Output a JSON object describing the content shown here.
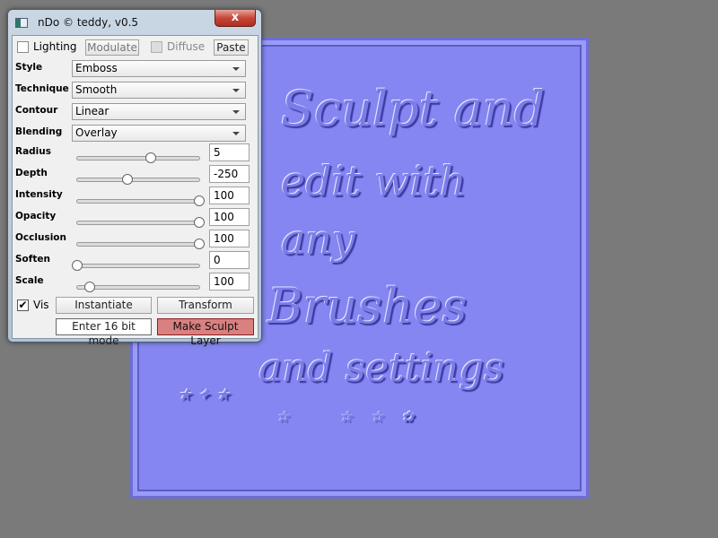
{
  "window": {
    "title": "nDo © teddy, v0.5",
    "close_label": "x"
  },
  "top_row": {
    "lighting_label": "Lighting",
    "lighting_checked": false,
    "modulate_label": "Modulate",
    "diffuse_label": "Diffuse",
    "diffuse_checked": false,
    "paste_label": "Paste"
  },
  "combos": [
    {
      "label": "Style",
      "value": "Emboss"
    },
    {
      "label": "Technique",
      "value": "Smooth"
    },
    {
      "label": "Contour",
      "value": "Linear"
    },
    {
      "label": "Blending",
      "value": "Overlay"
    }
  ],
  "sliders": [
    {
      "label": "Radius",
      "value": "5",
      "level": 0.6
    },
    {
      "label": "Depth",
      "value": "-250",
      "level": 0.41
    },
    {
      "label": "Intensity",
      "value": "100",
      "level": 1
    },
    {
      "label": "Opacity",
      "value": "100",
      "level": 1
    },
    {
      "label": "Occlusion",
      "value": "100",
      "level": 1
    },
    {
      "label": "Soften",
      "value": "0",
      "level": 0
    },
    {
      "label": "Scale",
      "value": "100",
      "level": 0.1
    }
  ],
  "bottom": {
    "vis_label": "Vis",
    "vis_checked": true,
    "instantiate_label": "Instantiate",
    "transform_label": "Transform",
    "enter16_label": "Enter 16 bit mode",
    "make_sculpt_label": "Make Sculpt Layer",
    "make_sculpt_color": "#d98080"
  },
  "canvas": {
    "bg_color": "#8686f2",
    "lines": [
      "Sculpt and",
      "edit with",
      "any",
      "Brushes",
      "and settings"
    ]
  }
}
